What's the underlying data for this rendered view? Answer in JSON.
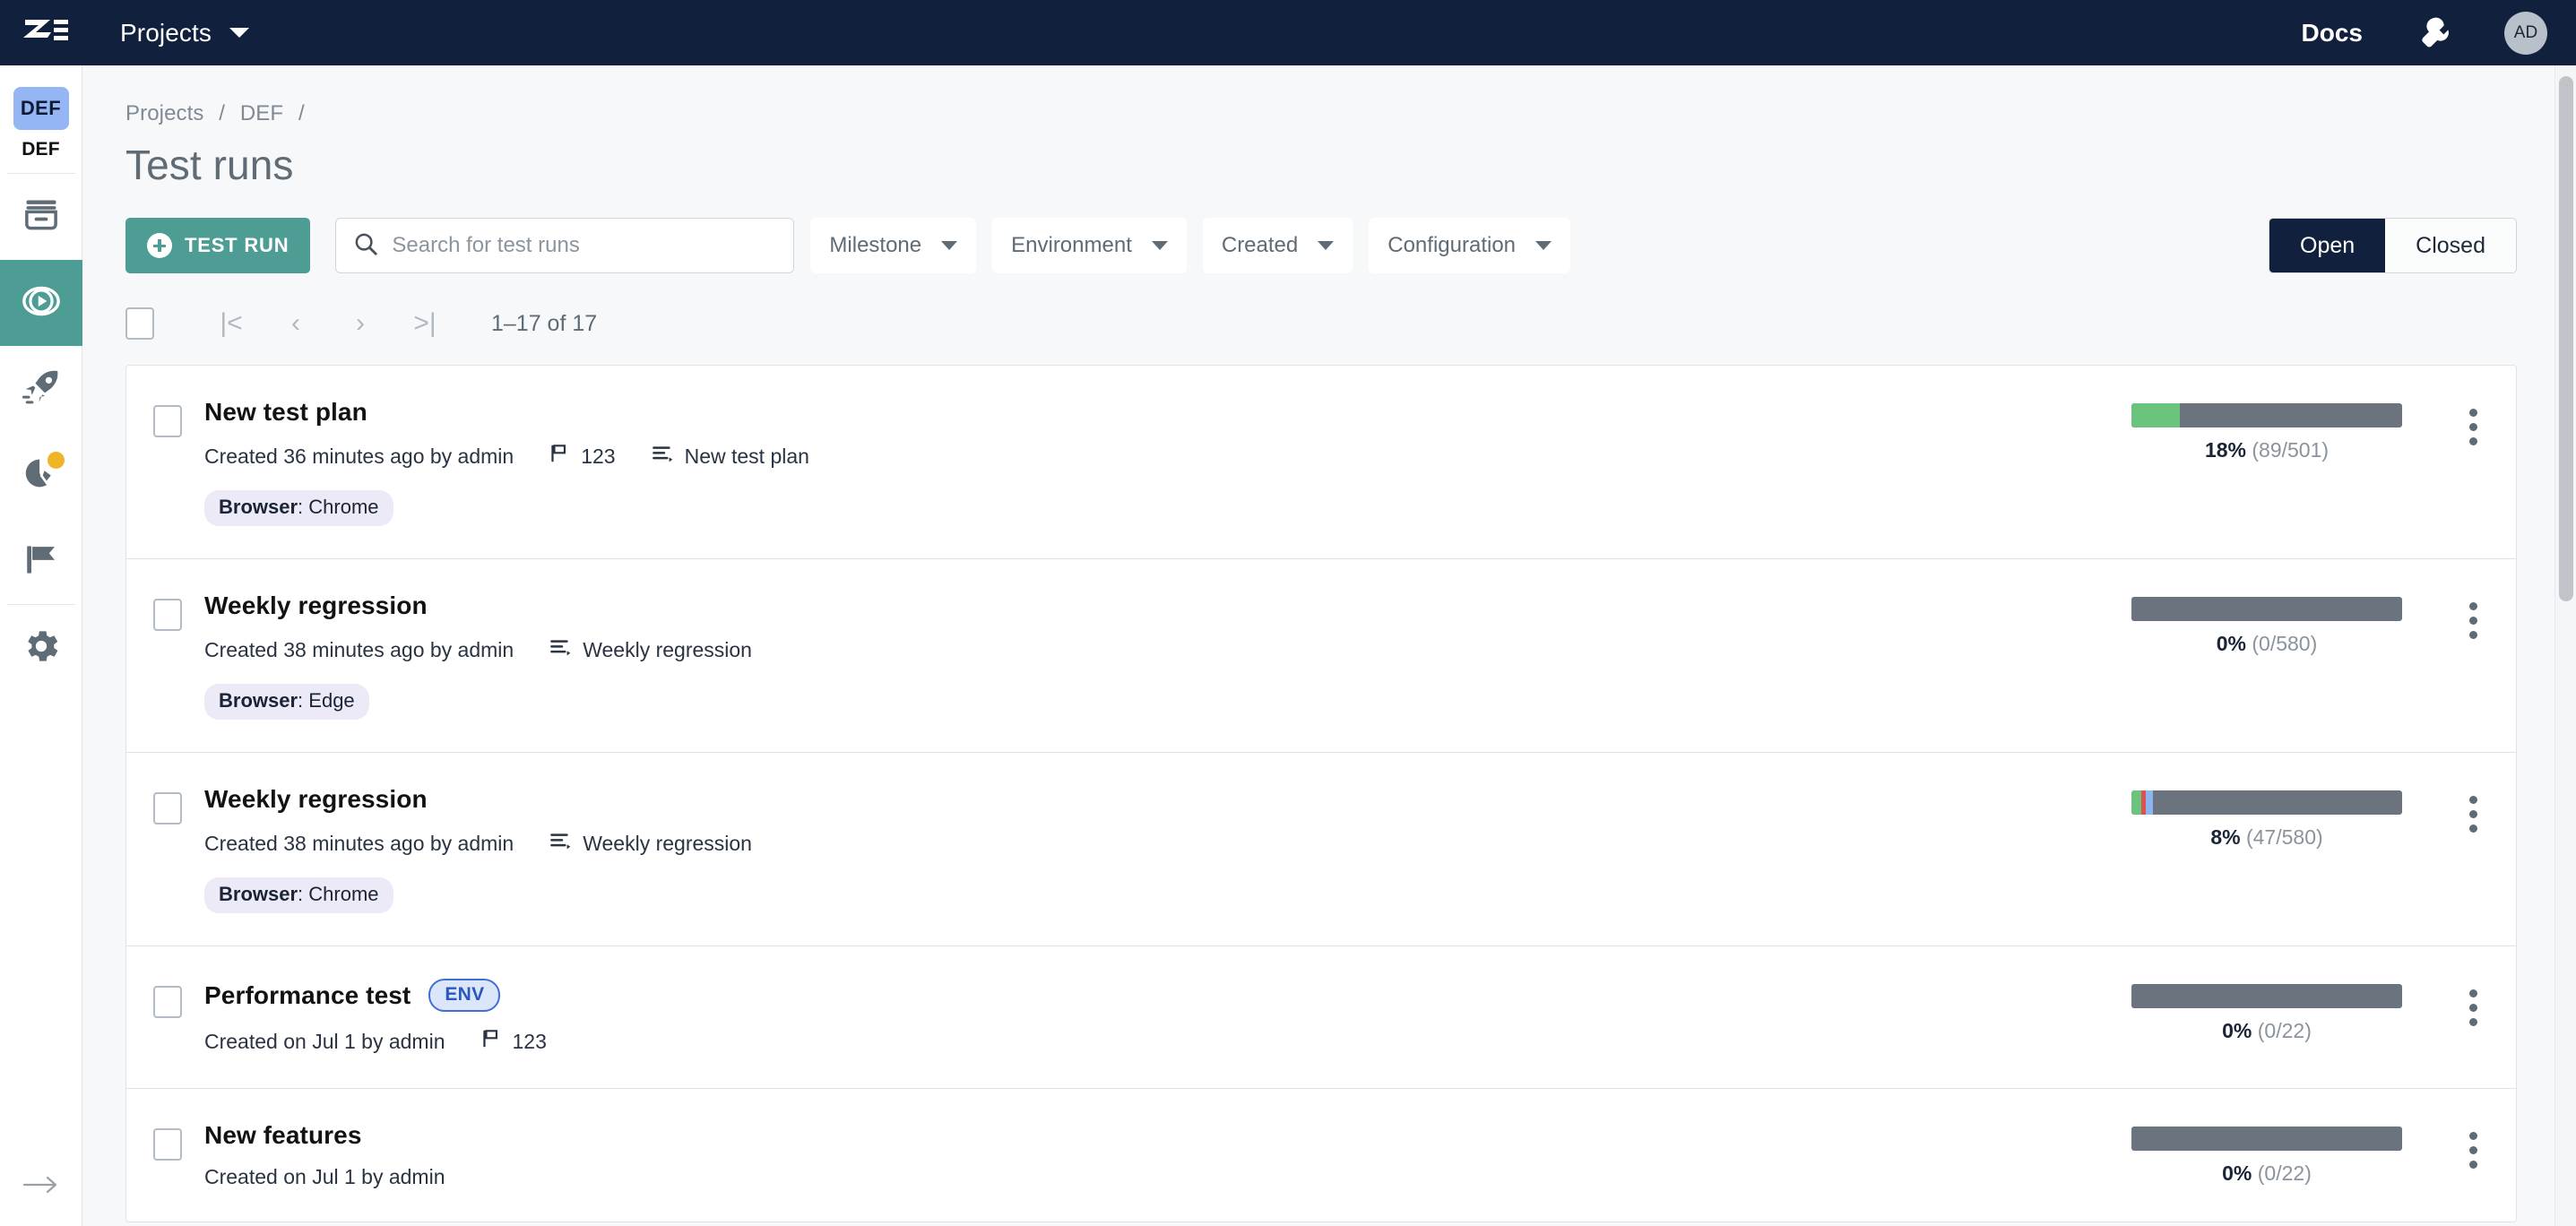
{
  "topbar": {
    "logo_icon": "zephyr-logo-icon",
    "projects_label": "Projects",
    "projects_caret_icon": "chevron-down-icon",
    "docs_label": "Docs",
    "wrench_icon": "wrench-icon",
    "avatar_initials": "AD",
    "background": "#11203c"
  },
  "sidebar": {
    "project_badge": "DEF",
    "project_label": "DEF",
    "items": [
      {
        "name": "repository",
        "icon": "archive-icon",
        "active": false
      },
      {
        "name": "test-runs",
        "icon": "play-circle-icon",
        "active": true
      },
      {
        "name": "releases",
        "icon": "rocket-icon",
        "active": false
      },
      {
        "name": "reports",
        "icon": "pie-chart-icon",
        "active": false,
        "badge_dot": "#f0b429"
      },
      {
        "name": "milestones",
        "icon": "flag-icon",
        "active": false
      },
      {
        "name": "settings",
        "icon": "gear-icon",
        "active": false
      }
    ],
    "expand_icon": "arrow-right-icon",
    "active_color": "#4e9d95"
  },
  "breadcrumb": {
    "items": [
      "Projects",
      "DEF"
    ],
    "separator": "/",
    "trailing_separator": "/"
  },
  "page": {
    "title": "Test runs"
  },
  "toolbar": {
    "create_button": {
      "label": "TEST RUN",
      "icon": "plus-circle-icon",
      "color": "#4e9d95"
    },
    "search": {
      "placeholder": "Search for test runs",
      "value": "",
      "icon": "search-icon"
    },
    "filters": [
      {
        "label": "Milestone",
        "icon": "chevron-down-icon"
      },
      {
        "label": "Environment",
        "icon": "chevron-down-icon"
      },
      {
        "label": "Created",
        "icon": "chevron-down-icon"
      },
      {
        "label": "Configuration",
        "icon": "chevron-down-icon"
      }
    ],
    "status_toggle": {
      "options": [
        "Open",
        "Closed"
      ],
      "selected": "Open"
    }
  },
  "pagination": {
    "select_all_checked": false,
    "first_icon": "|<",
    "prev_icon": "‹",
    "next_icon": "›",
    "last_icon": ">|",
    "range_label": "1–17 of 17"
  },
  "runs": [
    {
      "title": "New test plan",
      "env_badge": null,
      "created": "Created 36 minutes ago by admin",
      "milestone": {
        "icon": "flag-icon",
        "label": "123"
      },
      "plan": {
        "icon": "test-plan-icon",
        "label": "New test plan"
      },
      "tag": {
        "key": "Browser",
        "value": "Chrome"
      },
      "progress": {
        "percent_label": "18%",
        "counts_label": "(89/501)",
        "segments": [
          {
            "status": "passed",
            "color": "#6ac47e",
            "pct": 17.8
          }
        ],
        "remaining_color": "#6b747e"
      },
      "menu_icon": "kebab-menu-icon"
    },
    {
      "title": "Weekly regression",
      "env_badge": null,
      "created": "Created 38 minutes ago by admin",
      "milestone": null,
      "plan": {
        "icon": "test-plan-icon",
        "label": "Weekly regression"
      },
      "tag": {
        "key": "Browser",
        "value": "Edge"
      },
      "progress": {
        "percent_label": "0%",
        "counts_label": "(0/580)",
        "segments": [],
        "remaining_color": "#6b747e"
      },
      "menu_icon": "kebab-menu-icon"
    },
    {
      "title": "Weekly regression",
      "env_badge": null,
      "created": "Created 38 minutes ago by admin",
      "milestone": null,
      "plan": {
        "icon": "test-plan-icon",
        "label": "Weekly regression"
      },
      "tag": {
        "key": "Browser",
        "value": "Chrome"
      },
      "progress": {
        "percent_label": "8%",
        "counts_label": "(47/580)",
        "segments": [
          {
            "status": "passed",
            "color": "#6ac47e",
            "pct": 3.6
          },
          {
            "status": "failed",
            "color": "#d9534f",
            "pct": 1.7
          },
          {
            "status": "blocked",
            "color": "#8cb4f0",
            "pct": 2.7
          }
        ],
        "remaining_color": "#6b747e"
      },
      "menu_icon": "kebab-menu-icon"
    },
    {
      "title": "Performance test",
      "env_badge": "ENV",
      "created": "Created on Jul 1 by admin",
      "milestone": {
        "icon": "flag-icon",
        "label": "123"
      },
      "plan": null,
      "tag": null,
      "progress": {
        "percent_label": "0%",
        "counts_label": "(0/22)",
        "segments": [],
        "remaining_color": "#6b747e"
      },
      "menu_icon": "kebab-menu-icon"
    },
    {
      "title": "New features",
      "env_badge": null,
      "created": "Created on Jul 1 by admin",
      "milestone": null,
      "plan": null,
      "tag": null,
      "progress": {
        "percent_label": "0%",
        "counts_label": "(0/22)",
        "segments": [],
        "remaining_color": "#6b747e"
      },
      "menu_icon": "kebab-menu-icon"
    }
  ]
}
